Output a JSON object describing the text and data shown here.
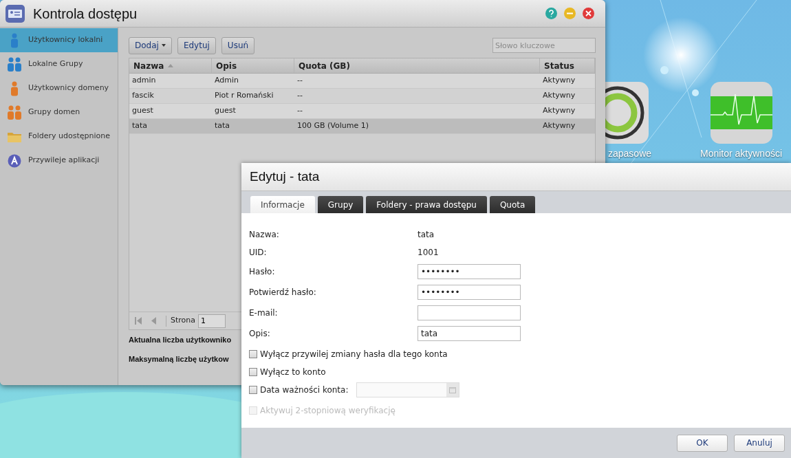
{
  "desktop": {
    "icons": [
      {
        "kind": "backup",
        "label": "zapasowe"
      },
      {
        "kind": "monitor",
        "label": "Monitor aktywności"
      }
    ]
  },
  "window": {
    "title": "Kontrola dostępu",
    "sidebar": {
      "items": [
        {
          "kind": "user",
          "label": "Użytkownicy lokalni",
          "selected": true
        },
        {
          "kind": "group",
          "label": "Lokalne Grupy",
          "selected": false
        },
        {
          "kind": "domain-user",
          "label": "Użytkownicy domeny",
          "selected": false
        },
        {
          "kind": "domain-group",
          "label": "Grupy domen",
          "selected": false
        },
        {
          "kind": "folder",
          "label": "Foldery udostępnione",
          "selected": false
        },
        {
          "kind": "app",
          "label": "Przywileje aplikacji",
          "selected": false
        }
      ]
    },
    "toolbar": {
      "buttons": [
        {
          "label": "Dodaj",
          "dropdown": true
        },
        {
          "label": "Edytuj",
          "dropdown": false
        },
        {
          "label": "Usuń",
          "dropdown": false
        }
      ],
      "search": {
        "placeholder": "Słowo kluczowe"
      }
    },
    "table": {
      "columns": [
        {
          "label": "Nazwa",
          "sorted": true
        },
        {
          "label": "Opis",
          "sorted": false
        },
        {
          "label": "Quota (GB)",
          "sorted": false
        },
        {
          "label": "Status",
          "sorted": false
        }
      ],
      "rows": [
        {
          "cells": [
            "admin",
            "Admin",
            "--",
            "Aktywny"
          ],
          "selected": false
        },
        {
          "cells": [
            "fascik",
            "Piot r Romański",
            "--",
            "Aktywny"
          ],
          "selected": false
        },
        {
          "cells": [
            "guest",
            "guest",
            "--",
            "Aktywny"
          ],
          "selected": false
        },
        {
          "cells": [
            "tata",
            "tata",
            "100 GB (Volume 1)",
            "Aktywny"
          ],
          "selected": true
        }
      ]
    },
    "pager": {
      "label": "Strona",
      "page": "1"
    },
    "summary": [
      "Aktualna liczba użytkowniko",
      "Maksymalną liczbę użytkow"
    ]
  },
  "dialog": {
    "title": "Edytuj - tata",
    "tabs": [
      {
        "label": "Informacje",
        "selected": true
      },
      {
        "label": "Grupy",
        "selected": false
      },
      {
        "label": "Foldery - prawa dostępu",
        "selected": false
      },
      {
        "label": "Quota",
        "selected": false
      }
    ],
    "fields": [
      {
        "kind": "text",
        "label": "Nazwa:",
        "value": "tata"
      },
      {
        "kind": "text",
        "label": "UID:",
        "value": "1001"
      },
      {
        "kind": "input",
        "label": "Hasło:",
        "value": "••••••••"
      },
      {
        "kind": "input",
        "label": "Potwierdź hasło:",
        "value": "••••••••"
      },
      {
        "kind": "input",
        "label": "E-mail:"
      },
      {
        "kind": "input",
        "label": "Opis:",
        "value": "tata"
      }
    ],
    "options": [
      {
        "kind": "checkbox",
        "label": "Wyłącz przywilej zmiany hasła dla tego konta",
        "checked": false,
        "disabled": false
      },
      {
        "kind": "checkbox",
        "label": "Wyłącz to konto",
        "checked": false,
        "disabled": false
      },
      {
        "kind": "date",
        "label": "Data ważności konta:",
        "checked": false,
        "disabled": false
      },
      {
        "kind": "checkbox",
        "label": "Aktywuj 2-stopniową weryfikację",
        "checked": false,
        "disabled": true
      }
    ],
    "buttons": [
      "OK",
      "Anuluj"
    ]
  }
}
